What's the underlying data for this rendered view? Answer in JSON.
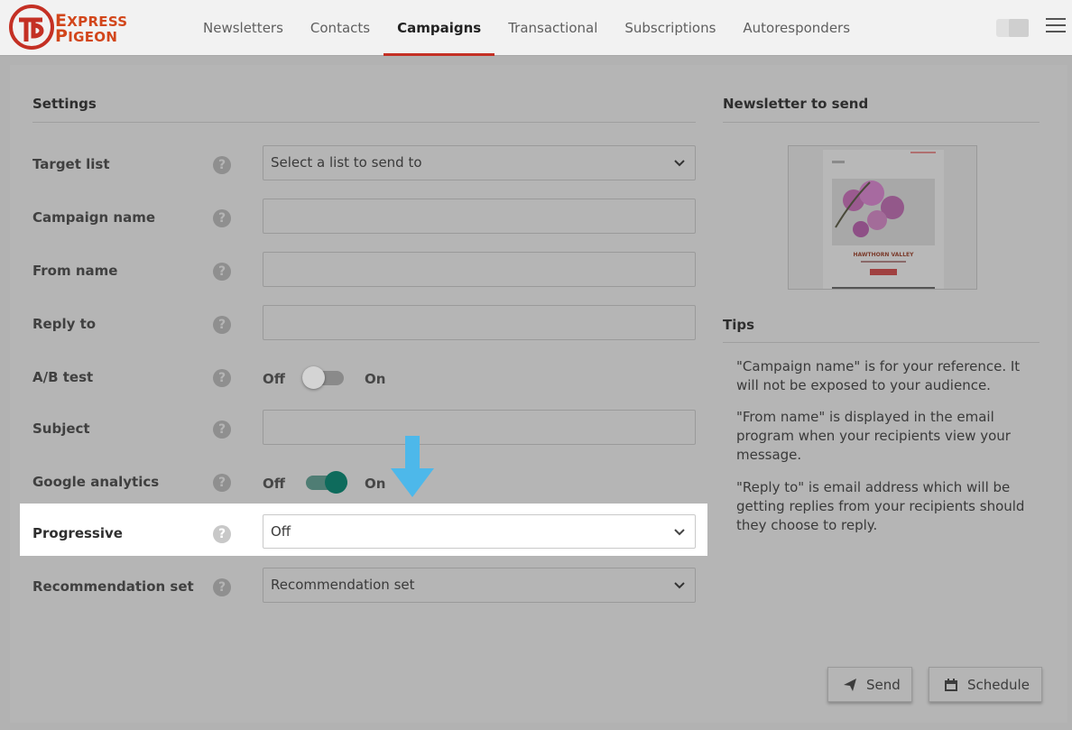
{
  "header": {
    "logo_text_line1": "XPRESS",
    "logo_text_line2": "IGEON",
    "nav": [
      "Newsletters",
      "Contacts",
      "Campaigns",
      "Transactional",
      "Subscriptions",
      "Autoresponders"
    ],
    "active_tab": "Campaigns"
  },
  "settings": {
    "title": "Settings",
    "target_list": {
      "label": "Target list",
      "placeholder": "Select a list to send to"
    },
    "campaign_name": {
      "label": "Campaign name",
      "value": ""
    },
    "from_name": {
      "label": "From name",
      "value": ""
    },
    "reply_to": {
      "label": "Reply to",
      "value": ""
    },
    "ab_test": {
      "label": "A/B test",
      "off": "Off",
      "on": "On",
      "state": "off"
    },
    "subject": {
      "label": "Subject",
      "value": ""
    },
    "google_analytics": {
      "label": "Google analytics",
      "off": "Off",
      "on": "On",
      "state": "on"
    },
    "progressive": {
      "label": "Progressive",
      "value": "Off"
    },
    "recommendation_set": {
      "label": "Recommendation set",
      "value": "Recommendation set"
    },
    "help_glyph": "?"
  },
  "newsletter": {
    "title": "Newsletter to send",
    "preview_caption": "HAWTHORN VALLEY"
  },
  "tips": {
    "title": "Tips",
    "items": [
      "\"Campaign name\" is for your reference. It will not be exposed to your audience.",
      "\"From name\" is displayed in the email program when your recipients view your message.",
      "\"Reply to\" is email address which will be getting replies from your recipients should they choose to reply."
    ]
  },
  "actions": {
    "send": "Send",
    "schedule": "Schedule"
  },
  "colors": {
    "accent": "#c43024",
    "toggle_on": "#0e6b5c",
    "arrow": "#4db8ea",
    "logo": "#d2461b"
  }
}
